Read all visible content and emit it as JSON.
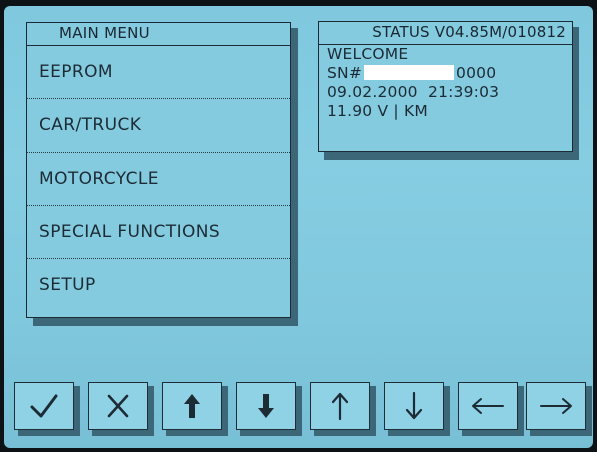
{
  "main_menu": {
    "title": "MAIN MENU",
    "items": [
      {
        "label": "EEPROM"
      },
      {
        "label": "CAR/TRUCK"
      },
      {
        "label": "MOTORCYCLE"
      },
      {
        "label": "SPECIAL FUNCTIONS"
      },
      {
        "label": "SETUP"
      }
    ]
  },
  "status": {
    "title": "STATUS V04.85M/010812",
    "welcome": "WELCOME",
    "sn_prefix": "SN#",
    "sn_suffix": "0000",
    "date": "09.02.2000",
    "time": "21:39:03",
    "voltage_line": "11.90 V | KM"
  },
  "buttons": [
    {
      "name": "confirm-button",
      "icon": "checkmark-icon"
    },
    {
      "name": "cancel-button",
      "icon": "x-icon"
    },
    {
      "name": "page-up-button",
      "icon": "bold-arrow-up-icon"
    },
    {
      "name": "page-down-button",
      "icon": "bold-arrow-down-icon"
    },
    {
      "name": "up-button",
      "icon": "arrow-up-icon"
    },
    {
      "name": "down-button",
      "icon": "arrow-down-icon"
    },
    {
      "name": "left-button",
      "icon": "arrow-left-icon"
    },
    {
      "name": "right-button",
      "icon": "arrow-right-icon"
    }
  ],
  "colors": {
    "screen_background": "#84cbe0",
    "ink": "#1d2b35"
  }
}
